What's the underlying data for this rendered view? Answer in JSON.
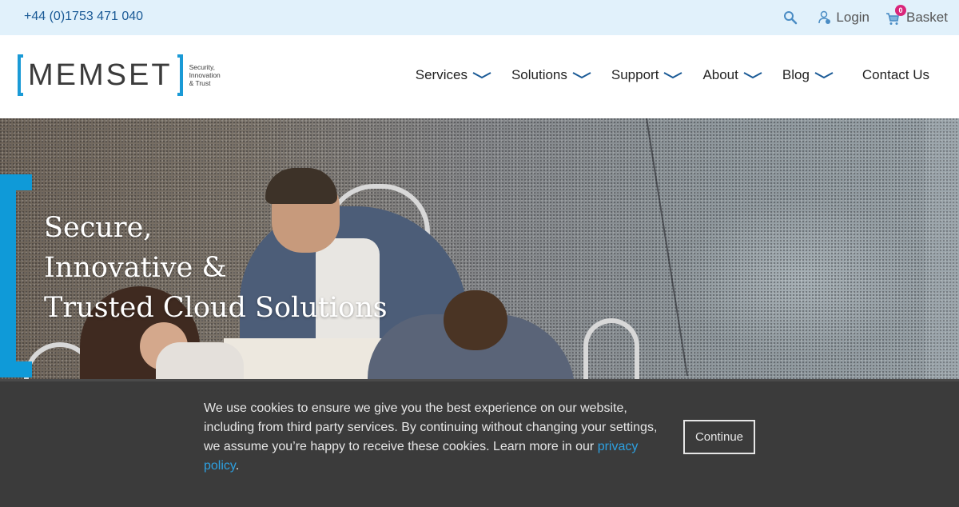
{
  "topbar": {
    "phone": "+44 (0)1753 471 040",
    "search_icon": "search-icon",
    "login_label": "Login",
    "basket_label": "Basket",
    "basket_count": "0"
  },
  "header": {
    "logo": {
      "wordmark": "MEMSET",
      "tagline_line1": "Security,",
      "tagline_line2": "Innovation",
      "tagline_line3": "& Trust"
    },
    "nav": [
      {
        "label": "Services",
        "has_dropdown": true
      },
      {
        "label": "Solutions",
        "has_dropdown": true
      },
      {
        "label": "Support",
        "has_dropdown": true
      },
      {
        "label": "About",
        "has_dropdown": true
      },
      {
        "label": "Blog",
        "has_dropdown": true
      },
      {
        "label": "Contact Us",
        "has_dropdown": false
      }
    ]
  },
  "hero": {
    "title_lines": [
      "Secure,",
      "Innovative &",
      "Trusted Cloud Solutions"
    ]
  },
  "cookie": {
    "text": "We use cookies to ensure we give you the best experience on our website, including from third party services. By continuing without changing your settings, we assume you’re happy to receive these cookies. Learn more in our ",
    "link_label": "privacy policy",
    "text_end": ".",
    "button_label": "Continue"
  },
  "colors": {
    "topbar_bg": "#e1f1fb",
    "brand_blue": "#0f9ad8",
    "phone_blue": "#1a5a96",
    "badge_pink": "#d9267a",
    "cookie_bg": "#3b3b3b",
    "link_blue": "#2da0e0"
  }
}
